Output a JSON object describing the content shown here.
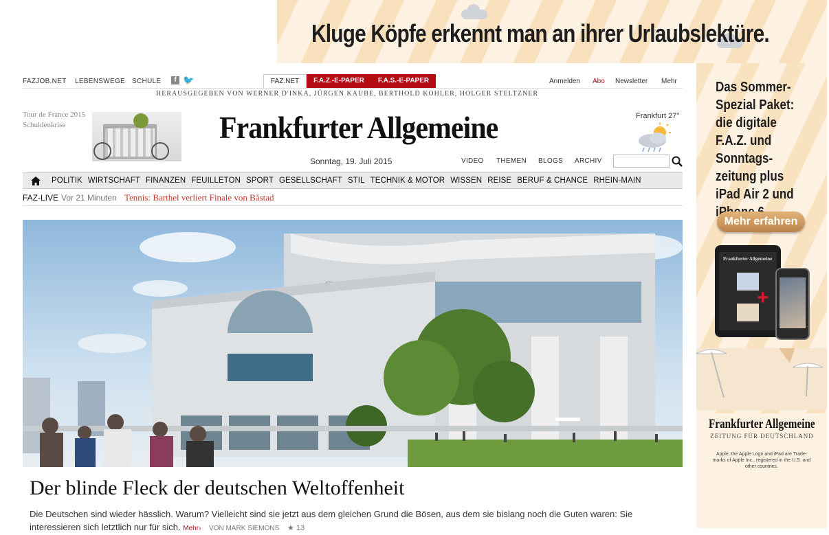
{
  "banner": {
    "headline": "Kluge Köpfe erkennt man an ihrer Urlaubslektüre."
  },
  "right_ad": {
    "copy": "Das Sommer-Spezial Paket: die digitale F.A.Z. und Sonntags-zeitung plus iPad Air 2 und iPhone 6.",
    "cta_label": "Mehr erfahren",
    "logo": "Frankfurter Allgemeine",
    "tagline": "ZEITUNG FÜR DEUTSCHLAND",
    "legal": "Apple, the Apple Logo and iPad are Trade-marks of Apple Inc., registered in the U.S. and other countries."
  },
  "header": {
    "left_links": [
      "FAZJOB.NET",
      "LEBENSWEGE",
      "SCHULE"
    ],
    "tabs": [
      "FAZ.NET",
      "F.A.Z.-E-PAPER",
      "F.A.S.-E-PAPER"
    ],
    "right_links": [
      "Anmelden",
      "Abo",
      "Newsletter",
      "Mehr"
    ],
    "publishers": "HERAUSGEGEBEN VON WERNER D'INKA, JÜRGEN KAUBE, BERTHOLD KOHLER, HOLGER STELTZNER",
    "teaser_line1": "Tour de France 2015",
    "teaser_line2": "Schuldenkrise",
    "masthead": "Frankfurter Allgemeine",
    "weather": "Frankfurt 27°",
    "date": "Sonntag, 19. Juli 2015",
    "section_links": [
      "VIDEO",
      "THEMEN",
      "BLOGS",
      "ARCHIV"
    ],
    "search_placeholder": ""
  },
  "nav": {
    "items": [
      "POLITIK",
      "WIRTSCHAFT",
      "FINANZEN",
      "FEUILLETON",
      "SPORT",
      "GESELLSCHAFT",
      "STIL",
      "TECHNIK & MOTOR",
      "WISSEN",
      "REISE",
      "BERUF & CHANCE",
      "RHEIN-MAIN"
    ]
  },
  "live": {
    "label": "FAZ-LIVE",
    "time": "Vor 21 Minuten",
    "headline": "Tennis: Barthel verliert Finale von Båstad"
  },
  "article": {
    "headline": "Der blinde Fleck der deutschen Weltoffenheit",
    "lead": "Die Deutschen sind wieder hässlich. Warum? Vielleicht sind sie jetzt aus dem gleichen Grund die Bösen, aus dem sie bislang noch die Guten waren: Sie interessieren sich letztlich nur für sich.",
    "more": "Mehr›",
    "byline": "Von MARK SIEMONS",
    "rating": "★ 13"
  },
  "colors": {
    "accent_red": "#b40d16",
    "ad_beige": "#fdf1e1"
  }
}
